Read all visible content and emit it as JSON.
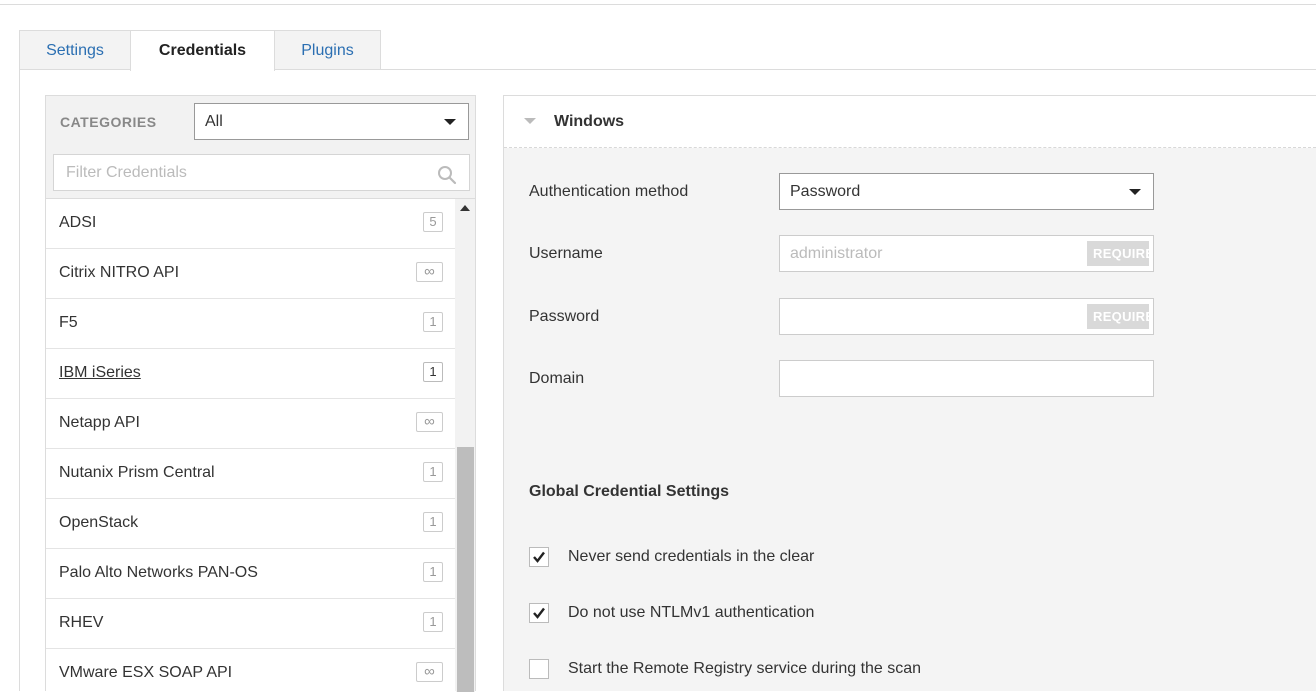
{
  "tabs": [
    {
      "label": "Settings",
      "active": false
    },
    {
      "label": "Credentials",
      "active": true
    },
    {
      "label": "Plugins",
      "active": false
    }
  ],
  "categories": {
    "label": "CATEGORIES",
    "selected": "All",
    "filter_placeholder": "Filter Credentials"
  },
  "credential_list": [
    {
      "label": "ADSI",
      "badge": "5"
    },
    {
      "label": "Citrix NITRO API",
      "badge": "∞"
    },
    {
      "label": "F5",
      "badge": "1"
    },
    {
      "label": "IBM iSeries",
      "badge": "1"
    },
    {
      "label": "Netapp API",
      "badge": "∞"
    },
    {
      "label": "Nutanix Prism Central",
      "badge": "1"
    },
    {
      "label": "OpenStack",
      "badge": "1"
    },
    {
      "label": "Palo Alto Networks PAN-OS",
      "badge": "1"
    },
    {
      "label": "RHEV",
      "badge": "1"
    },
    {
      "label": "VMware ESX SOAP API",
      "badge": "∞"
    }
  ],
  "windows": {
    "title": "Windows",
    "auth_label": "Authentication method",
    "auth_value": "Password",
    "username_label": "Username",
    "username_placeholder": "administrator",
    "password_label": "Password",
    "domain_label": "Domain",
    "required_badge": "REQUIRED"
  },
  "global": {
    "title": "Global Credential Settings",
    "options": [
      {
        "label": "Never send credentials in the clear",
        "checked": true
      },
      {
        "label": "Do not use NTLMv1 authentication",
        "checked": true
      },
      {
        "label": "Start the Remote Registry service during the scan",
        "checked": false
      }
    ]
  }
}
